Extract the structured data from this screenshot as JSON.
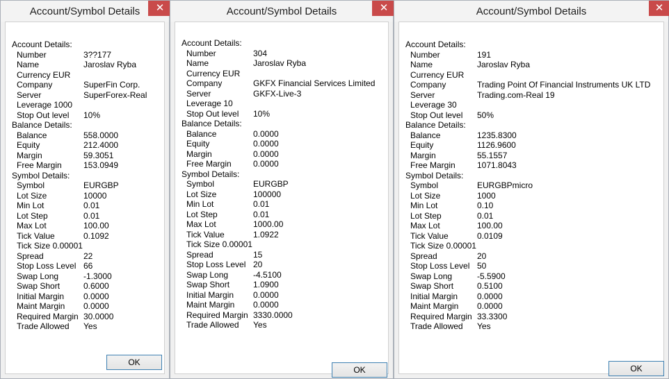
{
  "dialogs": [
    {
      "title": "Account/Symbol Details",
      "close_glyph": "✕",
      "ok_label": "OK",
      "rows": [
        {
          "label": "Account Details:",
          "value": ""
        },
        {
          "label": "Number",
          "value": "3??177"
        },
        {
          "label": "Name",
          "value": "Jaroslav Ryba"
        },
        {
          "label": "Currency EUR",
          "value": ""
        },
        {
          "label": "Company",
          "value": "SuperFin Corp."
        },
        {
          "label": "Server",
          "value": "SuperForex-Real"
        },
        {
          "label": "Leverage 1000",
          "value": ""
        },
        {
          "label": "Stop Out level",
          "value": "10%"
        },
        {
          "label": "Balance Details:",
          "value": ""
        },
        {
          "label": "Balance",
          "value": "558.0000"
        },
        {
          "label": "Equity",
          "value": "212.4000"
        },
        {
          "label": "Margin",
          "value": "59.3051"
        },
        {
          "label": "Free Margin",
          "value": "153.0949"
        },
        {
          "label": "Symbol Details:",
          "value": ""
        },
        {
          "label": "Symbol",
          "value": "EURGBP"
        },
        {
          "label": "Lot Size",
          "value": "10000"
        },
        {
          "label": "Min Lot",
          "value": "0.01"
        },
        {
          "label": "Lot Step",
          "value": "0.01"
        },
        {
          "label": "Max Lot",
          "value": "100.00"
        },
        {
          "label": "Tick Value",
          "value": "0.1092"
        },
        {
          "label": "Tick Size 0.00001",
          "value": ""
        },
        {
          "label": "Spread",
          "value": "22"
        },
        {
          "label": "Stop Loss Level",
          "value": "66"
        },
        {
          "label": "Swap Long",
          "value": "-1.3000"
        },
        {
          "label": "Swap Short",
          "value": "0.6000"
        },
        {
          "label": "Initial Margin",
          "value": "0.0000"
        },
        {
          "label": "Maint Margin",
          "value": "0.0000"
        },
        {
          "label": "Required Margin",
          "value": "30.0000"
        },
        {
          "label": "Trade Allowed",
          "value": "Yes"
        }
      ]
    },
    {
      "title": "Account/Symbol Details",
      "close_glyph": "✕",
      "ok_label": "OK",
      "rows": [
        {
          "label": "Account Details:",
          "value": ""
        },
        {
          "label": "Number",
          "value": "304"
        },
        {
          "label": "Name",
          "value": "Jaroslav  Ryba"
        },
        {
          "label": "Currency EUR",
          "value": ""
        },
        {
          "label": "Company",
          "value": "GKFX Financial Services Limited"
        },
        {
          "label": "Server",
          "value": "GKFX-Live-3"
        },
        {
          "label": "Leverage 10",
          "value": ""
        },
        {
          "label": "Stop Out level",
          "value": "10%"
        },
        {
          "label": "Balance Details:",
          "value": ""
        },
        {
          "label": "Balance",
          "value": "0.0000"
        },
        {
          "label": "Equity",
          "value": "0.0000"
        },
        {
          "label": "Margin",
          "value": "0.0000"
        },
        {
          "label": "Free Margin",
          "value": "0.0000"
        },
        {
          "label": "Symbol Details:",
          "value": ""
        },
        {
          "label": "Symbol",
          "value": "EURGBP"
        },
        {
          "label": "Lot Size",
          "value": "100000"
        },
        {
          "label": "Min Lot",
          "value": "0.01"
        },
        {
          "label": "Lot Step",
          "value": "0.01"
        },
        {
          "label": "Max Lot",
          "value": "1000.00"
        },
        {
          "label": "Tick Value",
          "value": "1.0922"
        },
        {
          "label": "Tick Size 0.00001",
          "value": ""
        },
        {
          "label": "Spread",
          "value": "15"
        },
        {
          "label": "Stop Loss Level",
          "value": "20"
        },
        {
          "label": "Swap Long",
          "value": "-4.5100"
        },
        {
          "label": "Swap Short",
          "value": "1.0900"
        },
        {
          "label": "Initial Margin",
          "value": "0.0000"
        },
        {
          "label": "Maint Margin",
          "value": "0.0000"
        },
        {
          "label": "Required Margin",
          "value": "3330.0000"
        },
        {
          "label": "Trade Allowed",
          "value": "Yes"
        }
      ]
    },
    {
      "title": "Account/Symbol Details",
      "close_glyph": "✕",
      "ok_label": "OK",
      "rows": [
        {
          "label": "Account Details:",
          "value": ""
        },
        {
          "label": "Number",
          "value": "191"
        },
        {
          "label": "Name",
          "value": "Jaroslav Ryba"
        },
        {
          "label": "Currency EUR",
          "value": ""
        },
        {
          "label": "Company",
          "value": "Trading Point Of Financial Instruments UK LTD"
        },
        {
          "label": "Server",
          "value": "Trading.com-Real 19"
        },
        {
          "label": "Leverage 30",
          "value": ""
        },
        {
          "label": "Stop Out level",
          "value": "50%"
        },
        {
          "label": "Balance Details:",
          "value": ""
        },
        {
          "label": "Balance",
          "value": "1235.8300"
        },
        {
          "label": "Equity",
          "value": "1126.9600"
        },
        {
          "label": "Margin",
          "value": "55.1557"
        },
        {
          "label": "Free Margin",
          "value": "1071.8043"
        },
        {
          "label": "Symbol Details:",
          "value": ""
        },
        {
          "label": "Symbol",
          "value": "EURGBPmicro"
        },
        {
          "label": "Lot Size",
          "value": "1000"
        },
        {
          "label": "Min Lot",
          "value": "0.10"
        },
        {
          "label": "Lot Step",
          "value": "0.01"
        },
        {
          "label": "Max Lot",
          "value": "100.00"
        },
        {
          "label": "Tick Value",
          "value": "0.0109"
        },
        {
          "label": "Tick Size 0.00001",
          "value": ""
        },
        {
          "label": "Spread",
          "value": "20"
        },
        {
          "label": "Stop Loss Level",
          "value": "50"
        },
        {
          "label": "Swap Long",
          "value": "-5.5900"
        },
        {
          "label": "Swap Short",
          "value": "0.5100"
        },
        {
          "label": "Initial Margin",
          "value": "0.0000"
        },
        {
          "label": "Maint Margin",
          "value": "0.0000"
        },
        {
          "label": "Required Margin",
          "value": "33.3300"
        },
        {
          "label": "Trade Allowed",
          "value": "Yes"
        }
      ]
    }
  ]
}
